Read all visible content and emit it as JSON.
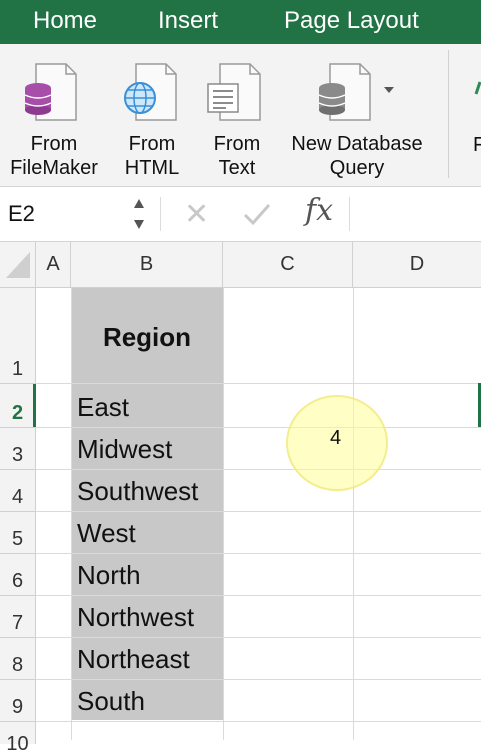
{
  "ribbon_tabs": [
    "Home",
    "Insert",
    "Page Layout"
  ],
  "ribbon_buttons": [
    {
      "line1": "From",
      "line2": "FileMaker",
      "icon": "filemaker-database-icon"
    },
    {
      "line1": "From",
      "line2": "HTML",
      "icon": "html-globe-icon"
    },
    {
      "line1": "From",
      "line2": "Text",
      "icon": "text-file-icon"
    },
    {
      "line1": "New Database",
      "line2": "Query",
      "icon": "database-query-icon"
    }
  ],
  "ribbon_cut_label": "F",
  "formula_bar": {
    "name_box": "E2",
    "fx_label": "fx",
    "formula": ""
  },
  "columns": [
    "A",
    "B",
    "C",
    "D"
  ],
  "rows": [
    "1",
    "2",
    "3",
    "4",
    "5",
    "6",
    "7",
    "8",
    "9",
    "10"
  ],
  "cells": {
    "B1": "Region",
    "B2": "East",
    "B3": "Midwest",
    "B4": "Southwest",
    "B5": "West",
    "B6": "North",
    "B7": "Northwest",
    "B8": "Northeast",
    "B9": "South"
  },
  "click_highlight_value": "4",
  "colors": {
    "accent": "#217346",
    "selected_column_fill": "#c8c8c8"
  }
}
